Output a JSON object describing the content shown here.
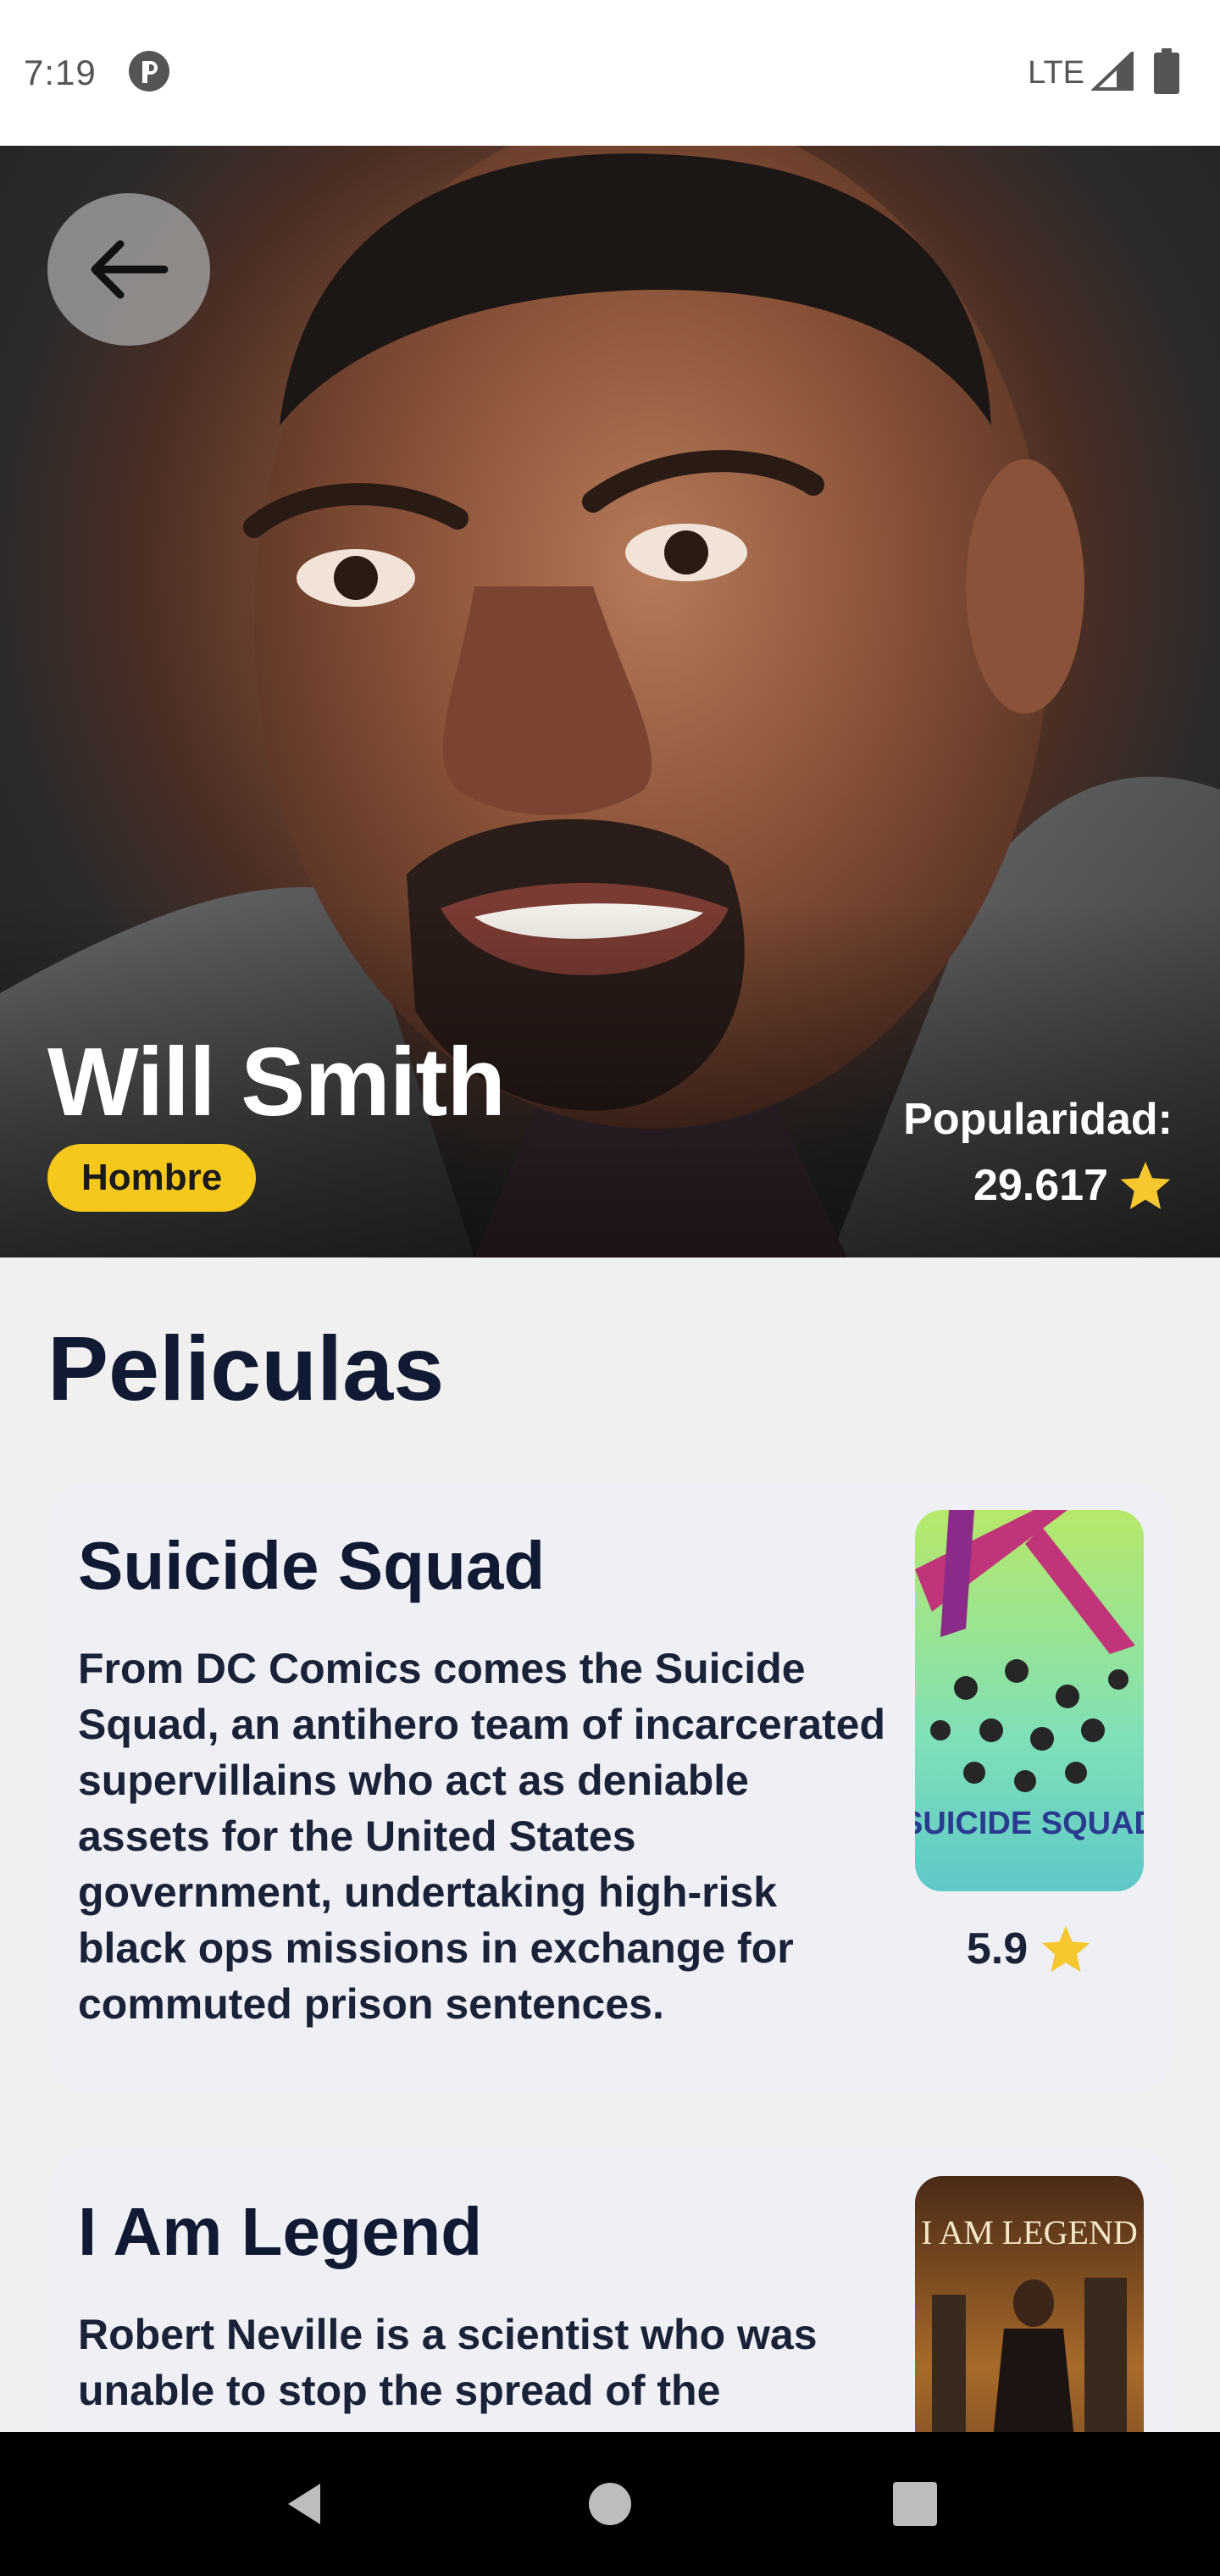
{
  "status_bar": {
    "time": "7:19",
    "network": "LTE"
  },
  "actor": {
    "name": "Will Smith",
    "gender": "Hombre",
    "popularity_label": "Popularidad:",
    "popularity_value": "29.617"
  },
  "section": {
    "title": "Peliculas"
  },
  "movies": [
    {
      "title": "Suicide Squad",
      "overview": "From DC Comics comes the Suicide Squad, an antihero team of incarcerated supervillains who act as deniable assets for the United States government, undertaking high-risk black ops missions in exchange for commuted prison sentences.",
      "rating": "5.9",
      "poster_text": "SUICIDE SQUAD"
    },
    {
      "title": "I Am Legend",
      "overview": "Robert Neville is a scientist who was unable to stop the spread of the",
      "poster_text": "I AM LEGEND"
    }
  ],
  "colors": {
    "accent": "#f6c81b",
    "title_text": "#111a33",
    "card_bg": "#eef0f5",
    "page_bg": "#f0f0f0"
  },
  "icons": {
    "back": "arrow-left-icon",
    "star": "star-icon",
    "nav_back": "triangle-back-icon",
    "nav_home": "circle-home-icon",
    "nav_recents": "square-recents-icon"
  }
}
